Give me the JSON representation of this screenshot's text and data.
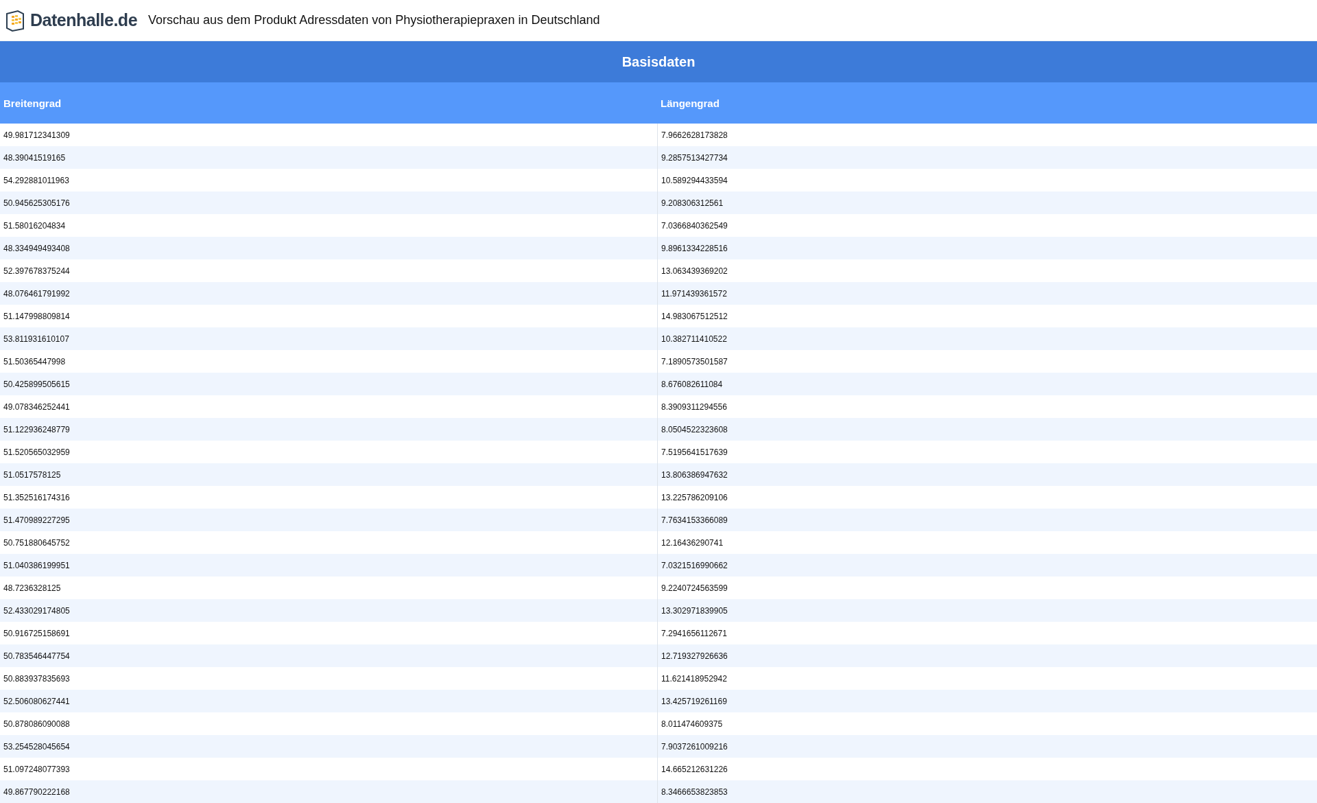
{
  "header": {
    "logo_text": "Datenhalle.de",
    "title": "Vorschau aus dem Produkt Adressdaten von Physiotherapiepraxen in Deutschland"
  },
  "table": {
    "section_title": "Basisdaten",
    "columns": [
      "Breitengrad",
      "Längengrad"
    ],
    "rows": [
      [
        "49.981712341309",
        "7.9662628173828"
      ],
      [
        "48.39041519165",
        "9.2857513427734"
      ],
      [
        "54.292881011963",
        "10.589294433594"
      ],
      [
        "50.945625305176",
        "9.208306312561"
      ],
      [
        "51.58016204834",
        "7.0366840362549"
      ],
      [
        "48.334949493408",
        "9.8961334228516"
      ],
      [
        "52.397678375244",
        "13.063439369202"
      ],
      [
        "48.076461791992",
        "11.971439361572"
      ],
      [
        "51.147998809814",
        "14.983067512512"
      ],
      [
        "53.811931610107",
        "10.382711410522"
      ],
      [
        "51.50365447998",
        "7.1890573501587"
      ],
      [
        "50.425899505615",
        "8.676082611084"
      ],
      [
        "49.078346252441",
        "8.3909311294556"
      ],
      [
        "51.122936248779",
        "8.0504522323608"
      ],
      [
        "51.520565032959",
        "7.5195641517639"
      ],
      [
        "51.0517578125",
        "13.806386947632"
      ],
      [
        "51.352516174316",
        "13.225786209106"
      ],
      [
        "51.470989227295",
        "7.7634153366089"
      ],
      [
        "50.751880645752",
        "12.16436290741"
      ],
      [
        "51.040386199951",
        "7.0321516990662"
      ],
      [
        "48.7236328125",
        "9.2240724563599"
      ],
      [
        "52.433029174805",
        "13.302971839905"
      ],
      [
        "50.916725158691",
        "7.2941656112671"
      ],
      [
        "50.783546447754",
        "12.719327926636"
      ],
      [
        "50.883937835693",
        "11.621418952942"
      ],
      [
        "52.506080627441",
        "13.425719261169"
      ],
      [
        "50.878086090088",
        "8.011474609375"
      ],
      [
        "53.254528045654",
        "7.9037261009216"
      ],
      [
        "51.097248077393",
        "14.665212631226"
      ],
      [
        "49.867790222168",
        "8.3466653823853"
      ]
    ]
  }
}
